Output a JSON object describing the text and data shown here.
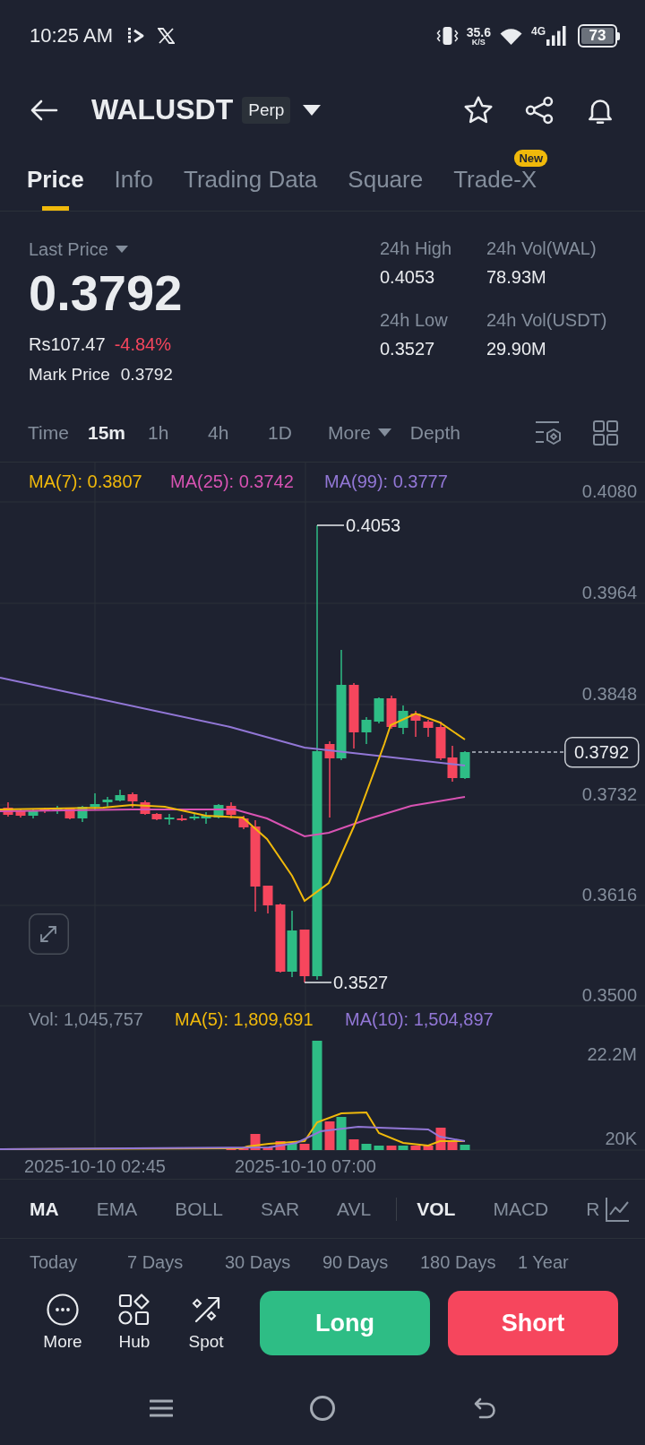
{
  "status_bar": {
    "time": "10:25 AM",
    "network_speed": "35.6",
    "speed_unit": "K/S",
    "network_type": "4G",
    "battery": "73"
  },
  "header": {
    "symbol": "WALUSDT",
    "contract_type": "Perp"
  },
  "tabs": [
    {
      "label": "Price",
      "selected": true
    },
    {
      "label": "Info",
      "selected": false
    },
    {
      "label": "Trading Data",
      "selected": false
    },
    {
      "label": "Square",
      "selected": false
    },
    {
      "label": "Trade-X",
      "selected": false,
      "badge": "New"
    }
  ],
  "ticker": {
    "price_type": "Last Price",
    "last_price": "0.3792",
    "local_price": "Rs107.47",
    "change": "-4.84%",
    "change_negative": true,
    "mark_price_label": "Mark Price",
    "mark_price": "0.3792",
    "stats": [
      {
        "label": "24h High",
        "value": "0.4053"
      },
      {
        "label": "24h Vol(WAL)",
        "value": "78.93M"
      },
      {
        "label": "24h Low",
        "value": "0.3527"
      },
      {
        "label": "24h Vol(USDT)",
        "value": "29.90M"
      }
    ]
  },
  "intervals": [
    {
      "label": "Time",
      "kind": "option",
      "selected": false
    },
    {
      "label": "15m",
      "kind": "option",
      "selected": true
    },
    {
      "label": "1h",
      "kind": "option",
      "selected": false
    },
    {
      "label": "4h",
      "kind": "option",
      "selected": false
    },
    {
      "label": "1D",
      "kind": "option",
      "selected": false
    },
    {
      "label": "More",
      "kind": "menu",
      "selected": false
    },
    {
      "label": "Depth",
      "kind": "option",
      "selected": false
    }
  ],
  "price_chart": {
    "legend": [
      {
        "label": "MA(7): 0.3807",
        "color": "#f0b90b"
      },
      {
        "label": "MA(25): 0.3742",
        "color": "#d853b3"
      },
      {
        "label": "MA(99): 0.3777",
        "color": "#9277d6"
      }
    ],
    "price_axis": [
      "0.4080",
      "0.3964",
      "0.3848",
      "0.3732",
      "0.3616",
      "0.3500"
    ],
    "high_marker": "0.4053",
    "low_marker": "0.3527",
    "last_price_tag": "0.3792"
  },
  "volume_chart": {
    "legend": [
      {
        "label": "Vol: 1,045,757",
        "color": "#848e9c"
      },
      {
        "label": "MA(5): 1,809,691",
        "color": "#f0b90b"
      },
      {
        "label": "MA(10): 1,504,897",
        "color": "#9277d6"
      }
    ],
    "volume_axis": [
      "22.2M",
      "20K"
    ],
    "time_axis": [
      "2025-10-10 02:45",
      "2025-10-10 07:00"
    ]
  },
  "main_indicators": [
    {
      "label": "MA",
      "selected": true
    },
    {
      "label": "EMA",
      "selected": false
    },
    {
      "label": "BOLL",
      "selected": false
    },
    {
      "label": "SAR",
      "selected": false
    },
    {
      "label": "AVL",
      "selected": false
    }
  ],
  "sub_indicators": [
    {
      "label": "VOL",
      "selected": true
    },
    {
      "label": "MACD",
      "selected": false
    },
    {
      "label": "R",
      "selected": false
    }
  ],
  "ranges": [
    {
      "label": "Today",
      "selected": false
    },
    {
      "label": "7 Days",
      "selected": false
    },
    {
      "label": "30 Days",
      "selected": false
    },
    {
      "label": "90 Days",
      "selected": false
    },
    {
      "label": "180 Days",
      "selected": false
    },
    {
      "label": "1 Year",
      "selected": false
    }
  ],
  "actions": [
    {
      "label": "More"
    },
    {
      "label": "Hub"
    },
    {
      "label": "Spot"
    }
  ],
  "trade_buttons": [
    {
      "label": "Long",
      "kind": "long"
    },
    {
      "label": "Short",
      "kind": "short"
    }
  ]
}
